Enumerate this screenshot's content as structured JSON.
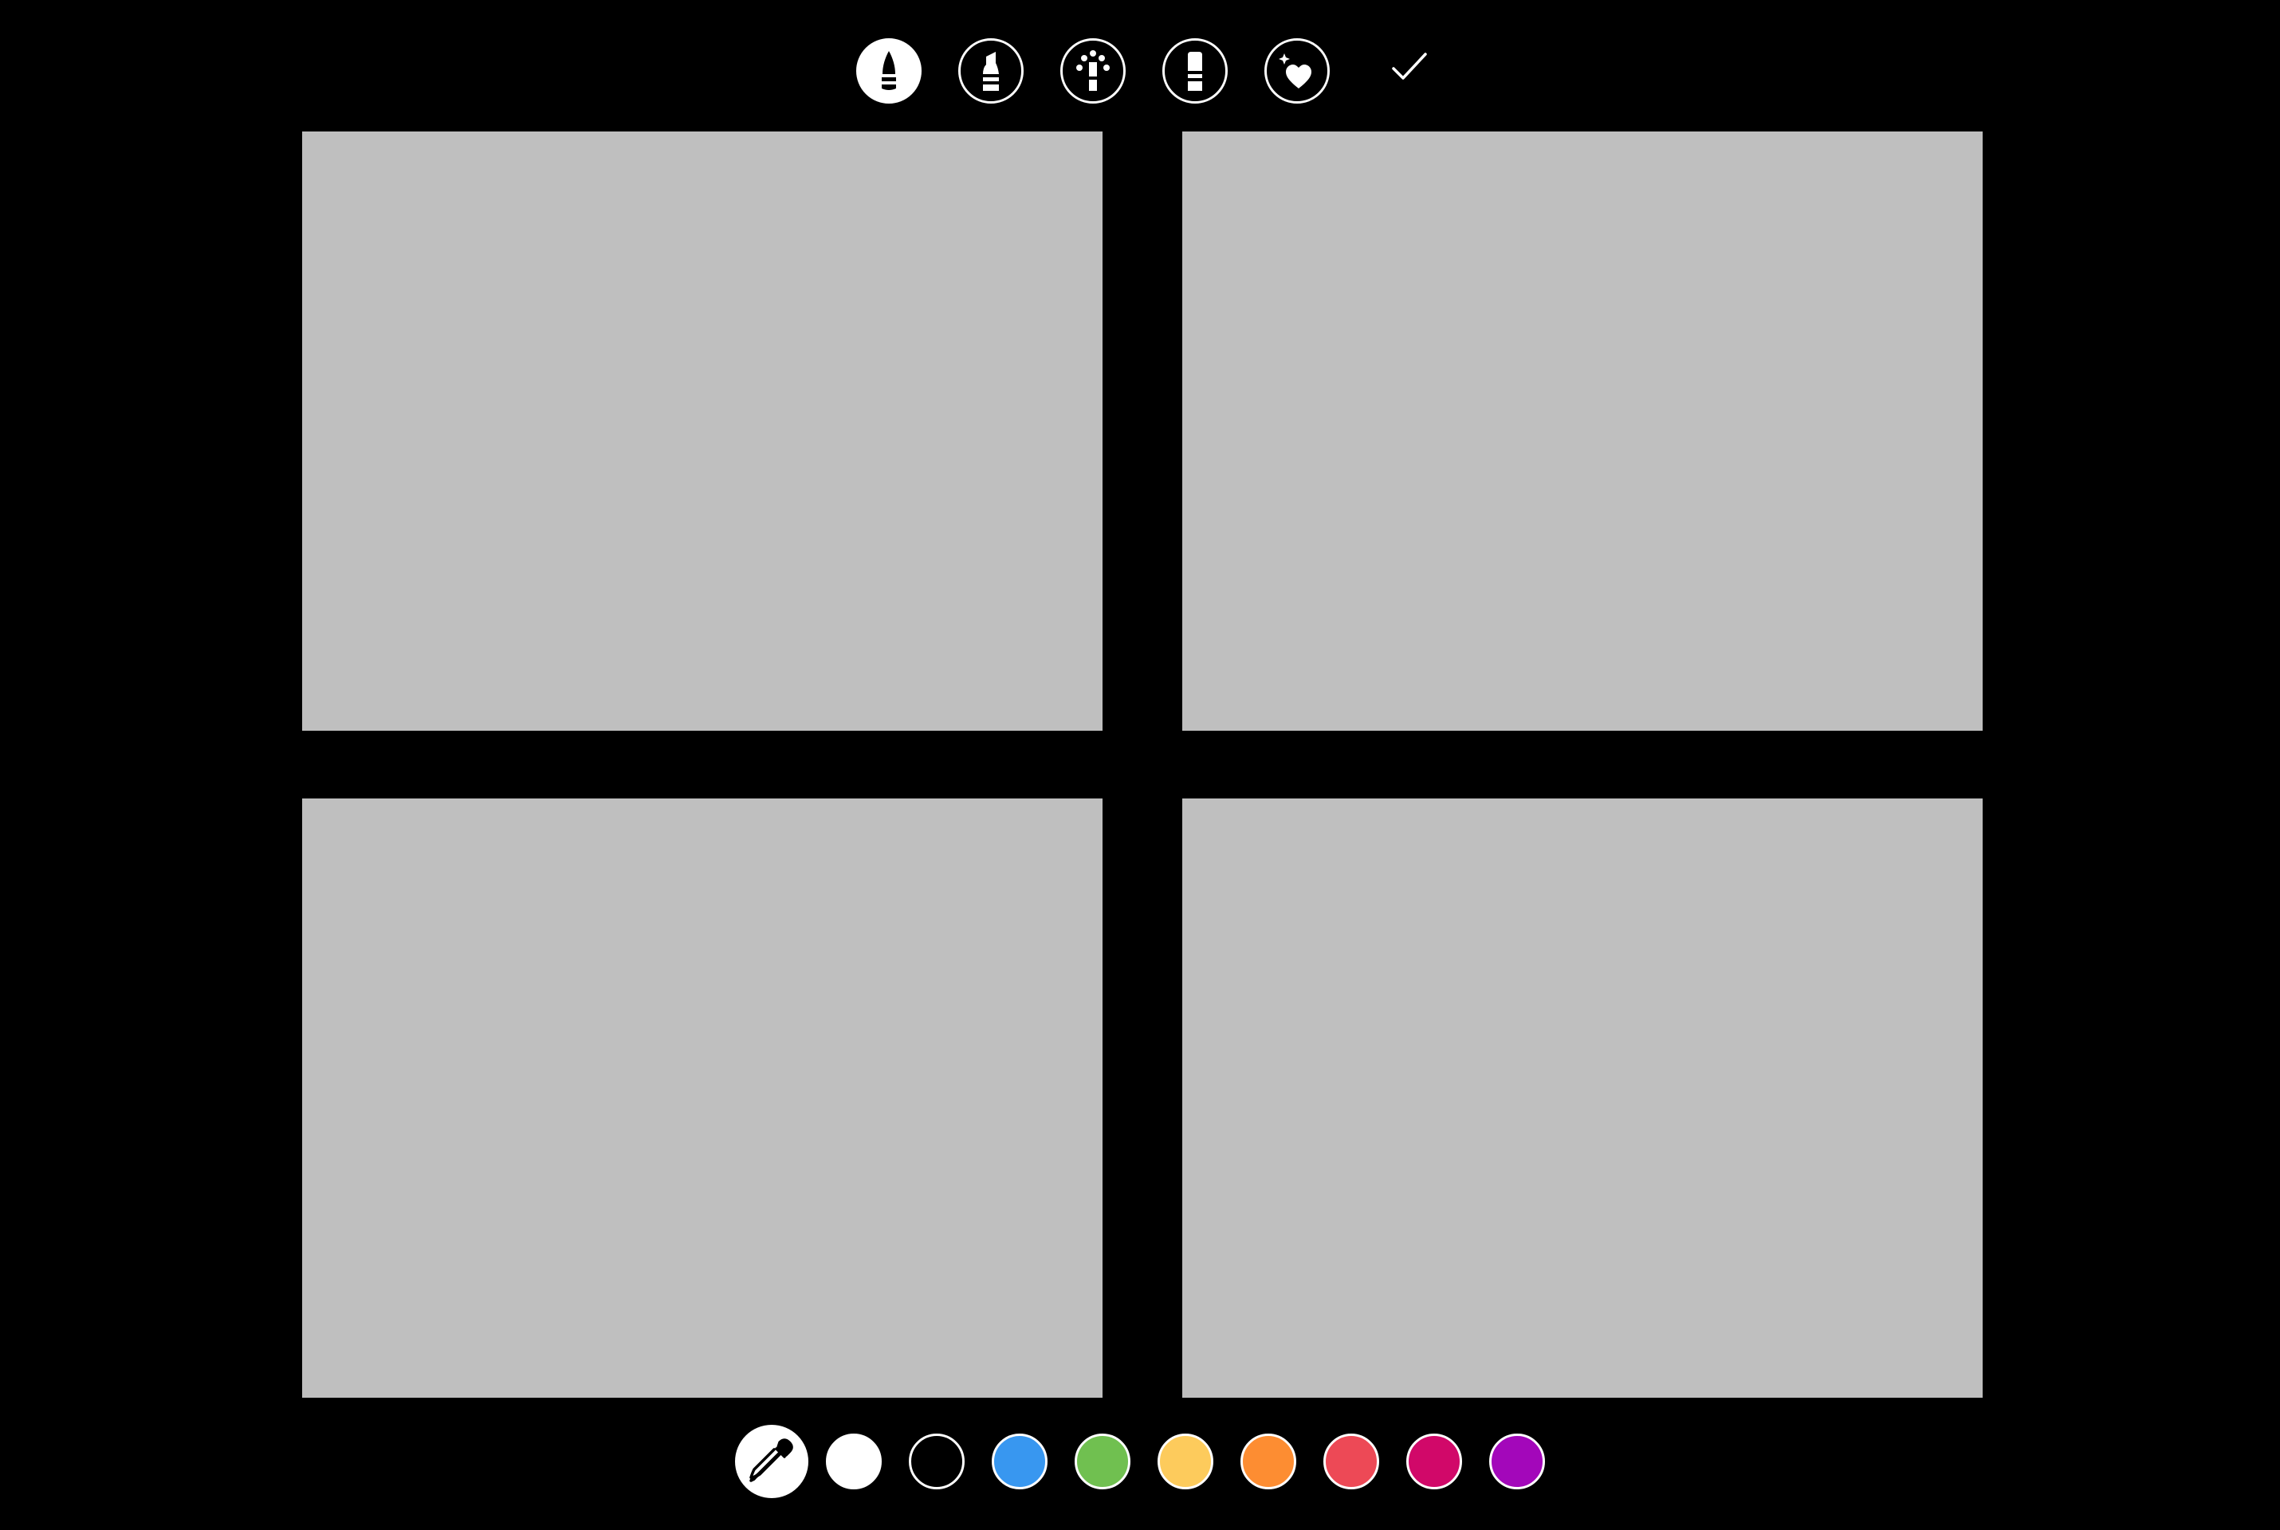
{
  "toolbar": {
    "tools": [
      {
        "name": "pen-tool",
        "icon": "pen-icon",
        "active": true
      },
      {
        "name": "marker-tool",
        "icon": "marker-icon",
        "active": false
      },
      {
        "name": "glow-tool",
        "icon": "glow-pen-icon",
        "active": false
      },
      {
        "name": "eraser-tool",
        "icon": "eraser-icon",
        "active": false
      },
      {
        "name": "sticker-tool",
        "icon": "sparkle-heart-icon",
        "active": false
      }
    ],
    "done_icon": "checkmark-icon"
  },
  "canvas": {
    "panels": [
      {
        "name": "photo-panel-top-left",
        "color": "#bfbfbf"
      },
      {
        "name": "photo-panel-top-right",
        "color": "#bfbfbf"
      },
      {
        "name": "photo-panel-bottom-left",
        "color": "#bfbfbf"
      },
      {
        "name": "photo-panel-bottom-right",
        "color": "#bfbfbf"
      }
    ]
  },
  "palette": {
    "eyedropper_icon": "eyedropper-icon",
    "colors": [
      {
        "name": "white",
        "hex": "#ffffff"
      },
      {
        "name": "black",
        "hex": "#000000"
      },
      {
        "name": "blue",
        "hex": "#3897f0"
      },
      {
        "name": "green",
        "hex": "#70c050"
      },
      {
        "name": "yellow",
        "hex": "#fdcb5c"
      },
      {
        "name": "orange",
        "hex": "#fd8d32"
      },
      {
        "name": "red",
        "hex": "#ed4956"
      },
      {
        "name": "pink",
        "hex": "#d10869"
      },
      {
        "name": "purple",
        "hex": "#a307ba"
      }
    ]
  }
}
